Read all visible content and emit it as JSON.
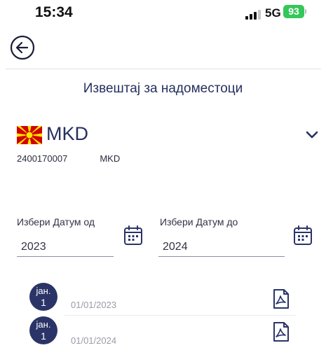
{
  "status_bar": {
    "time": "15:34",
    "network": "5G",
    "battery": "93"
  },
  "header": {
    "title": "Извештај за надоместоци",
    "back_icon": "arrow-left-circle-icon"
  },
  "account": {
    "currency": "MKD",
    "number_start": "2400170007",
    "number_end": "MKD",
    "flag_icon": "macedonia-flag-icon",
    "expand_icon": "chevron-down-icon"
  },
  "date_from": {
    "label": "Избери Датум од",
    "value": "2023",
    "icon": "calendar-icon"
  },
  "date_to": {
    "label": "Избери Датум до",
    "value": "2024",
    "icon": "calendar-icon"
  },
  "items": [
    {
      "month": "јан.",
      "day": "1",
      "date": "01/01/2023",
      "icon": "pdf-icon"
    },
    {
      "month": "јан.",
      "day": "1",
      "date": "01/01/2024",
      "icon": "pdf-icon"
    }
  ],
  "colors": {
    "primary": "#2b3467",
    "accent": "#25305e",
    "battery": "#34c759",
    "flag_red": "#d20000",
    "flag_yellow": "#ffe600"
  }
}
